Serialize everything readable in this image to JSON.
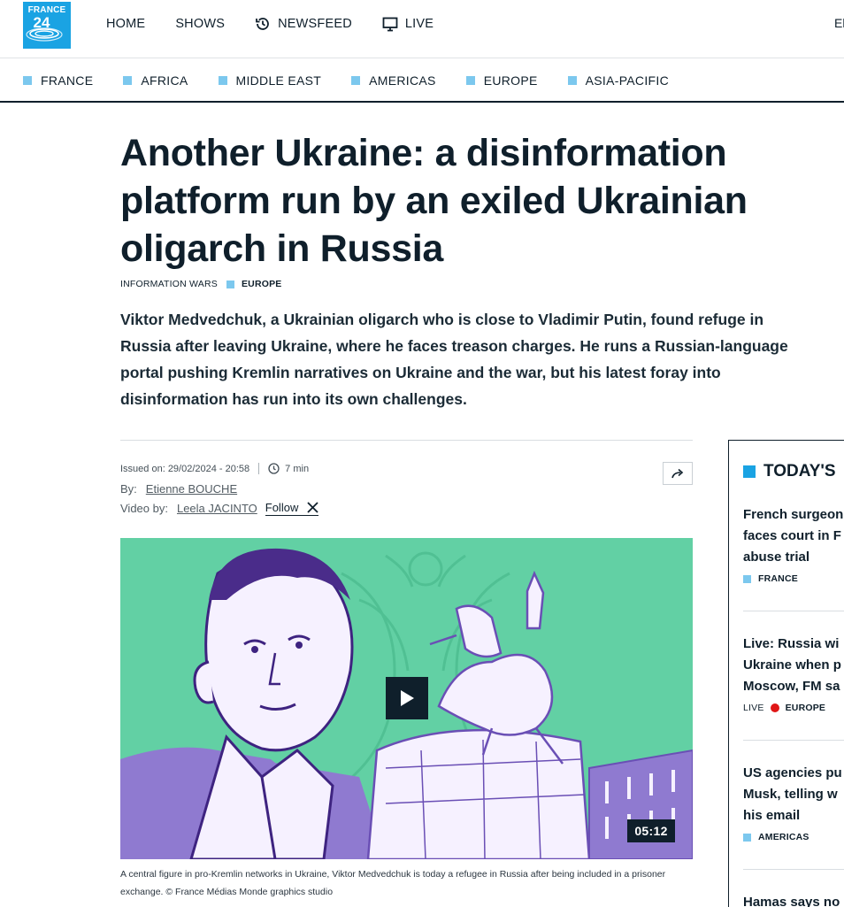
{
  "header": {
    "logo": {
      "line1": "FRANCE",
      "line2": "24"
    },
    "nav": [
      {
        "label": "HOME",
        "icon": ""
      },
      {
        "label": "SHOWS",
        "icon": ""
      },
      {
        "label": "NEWSFEED",
        "icon": "history-icon"
      },
      {
        "label": "LIVE",
        "icon": "tv-icon"
      }
    ],
    "lang_partial": "El"
  },
  "regions": [
    "FRANCE",
    "AFRICA",
    "MIDDLE EAST",
    "AMERICAS",
    "EUROPE",
    "ASIA-PACIFIC"
  ],
  "article": {
    "title": "Another Ukraine: a disinformation platform run by an exiled Ukrainian oligarch in Russia",
    "tags": {
      "primary": "INFORMATION WARS",
      "region": "EUROPE"
    },
    "lead": "Viktor Medvedchuk, a Ukrainian oligarch who is close to Vladimir Putin, found refuge in Russia after leaving Ukraine, where he faces treason charges. He runs a Russian-language portal pushing Kremlin narratives on Ukraine and the war, but his latest foray into disinformation has run into its own challenges.",
    "meta": {
      "issued": "Issued on: 29/02/2024 - 20:58",
      "read_time": "7 min"
    },
    "byline": {
      "label": "By:",
      "author": "Etienne BOUCHE"
    },
    "videoby": {
      "label": "Video by:",
      "author": "Leela JACINTO",
      "follow": "Follow"
    },
    "video": {
      "duration": "05:12"
    },
    "caption": "A central figure in pro-Kremlin networks in Ukraine, Viktor Medvedchuk is today a refugee in Russia after being included in a prisoner exchange.  © France Médias Monde graphics studio"
  },
  "sidebar": {
    "heading": "TODAY'S",
    "items": [
      {
        "lines": [
          "French surgeon",
          "faces court in F",
          "abuse trial"
        ],
        "tag": "FRANCE",
        "live": ""
      },
      {
        "lines": [
          "Live: Russia wi",
          "Ukraine when p",
          "Moscow, FM sa"
        ],
        "tag": "EUROPE",
        "live": "LIVE"
      },
      {
        "lines": [
          "US agencies pu",
          "Musk, telling w",
          "his email"
        ],
        "tag": "AMERICAS",
        "live": ""
      },
      {
        "lines": [
          "Hamas says no"
        ],
        "tag": "",
        "live": ""
      }
    ]
  },
  "colors": {
    "brand": "#1aa3e3",
    "region_square": "#7cc8ee",
    "ink": "#0f1f2b",
    "media_bg": "#62d0a4",
    "illustration": "#4a2c8a",
    "live_dot": "#e01616"
  }
}
